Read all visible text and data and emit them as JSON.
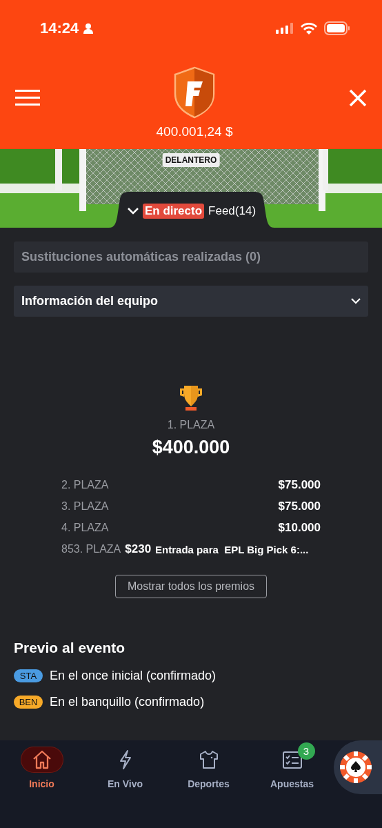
{
  "status_bar": {
    "time": "14:24"
  },
  "header": {
    "balance": "400.001,24 $"
  },
  "pitch": {
    "position_label": "DELANTERO"
  },
  "feed_tab": {
    "expanded": false,
    "live_badge": "En directo",
    "label": "Feed(14)"
  },
  "sections": [
    {
      "kind": "static",
      "title": "Sustituciones automáticas realizadas (0)"
    },
    {
      "kind": "dropdown",
      "title": "Información del equipo",
      "expanded": false
    }
  ],
  "prizes": {
    "top": {
      "place": "1. PLAZA",
      "amount": "$400.000"
    },
    "rows": [
      {
        "place": "2. PLAZA",
        "amount": "$75.000"
      },
      {
        "place": "3. PLAZA",
        "amount": "$75.000"
      },
      {
        "place": "4. PLAZA",
        "amount": "$10.000"
      }
    ],
    "extra": {
      "place": "853. PLAZA",
      "amount": "$230",
      "note": "Entrada para  EPL Big Pick 6:..."
    },
    "button": "Mostrar todos los premios"
  },
  "pre_event": {
    "title": "Previo al evento",
    "legend": [
      {
        "code": "STA",
        "text": "En el once inicial (confirmado)",
        "color": "#4a9be2"
      },
      {
        "code": "BEN",
        "text": "En el banquillo (confirmado)",
        "color": "#f7a928"
      }
    ]
  },
  "nav": [
    {
      "kind": "home",
      "label": "Inicio",
      "selected": true
    },
    {
      "kind": "bolt",
      "label": "En Vivo",
      "selected": false
    },
    {
      "kind": "shirt",
      "label": "Deportes",
      "selected": false
    },
    {
      "kind": "slip",
      "label": "Apuestas",
      "selected": false,
      "badge": "3"
    }
  ]
}
